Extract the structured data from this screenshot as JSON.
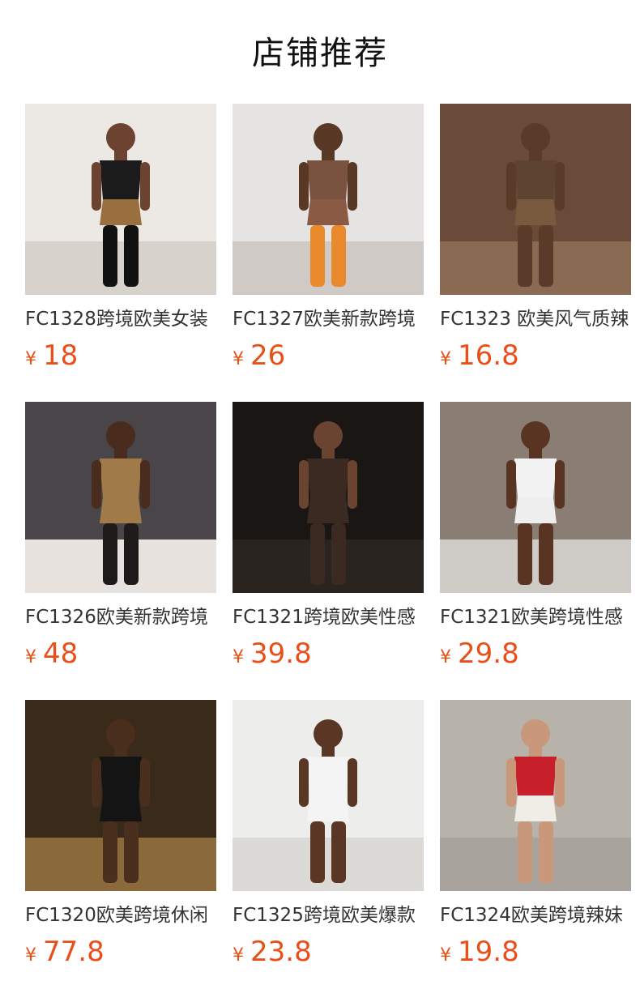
{
  "section": {
    "title": "店铺推荐"
  },
  "currency_symbol": "¥",
  "colors": {
    "price": "#e8501a",
    "title": "#111111",
    "name": "#333333"
  },
  "products": [
    {
      "name": "FC1328跨境欧美女装",
      "price": "18",
      "bg": "#ece8e4",
      "floor": "#d8d2cc",
      "skin": "#6b4330",
      "top": "#1b1b1b",
      "bottom": "#9a7040",
      "legs": "#111111"
    },
    {
      "name": "FC1327欧美新款跨境",
      "price": "26",
      "bg": "#e6e4e2",
      "floor": "#cfcac6",
      "skin": "#5a3826",
      "top": "#7a5240",
      "bottom": "#8a5a44",
      "legs": "#e88a2c"
    },
    {
      "name": "FC1323 欧美风气质辣",
      "price": "16.8",
      "bg": "#6a4a38",
      "floor": "#8a6a52",
      "skin": "#5a3a28",
      "top": "#5e4330",
      "bottom": "#7a5a3e",
      "legs": "#5a3a28"
    },
    {
      "name": "FC1326欧美新款跨境",
      "price": "48",
      "bg": "#4a4548",
      "floor": "#e8e2de",
      "skin": "#4a2c1e",
      "top": "#a07a48",
      "bottom": "#a07a48",
      "legs": "#1e1a1a"
    },
    {
      "name": "FC1321跨境欧美性感",
      "price": "39.8",
      "bg": "#1a1614",
      "floor": "#2a2420",
      "skin": "#6a4430",
      "top": "#3a2a22",
      "bottom": "#3a2a22",
      "legs": "#3a2a22"
    },
    {
      "name": "FC1321欧美跨境性感",
      "price": "29.8",
      "bg": "#8a7e74",
      "floor": "#cfcbc6",
      "skin": "#5a3422",
      "top": "#f2f2f2",
      "bottom": "#eeeeee",
      "legs": "#5a3422"
    },
    {
      "name": "FC1320欧美跨境休闲",
      "price": "77.8",
      "bg": "#3a2a1a",
      "floor": "#8a6a3a",
      "skin": "#4a2e1e",
      "top": "#141414",
      "bottom": "#141414",
      "legs": "#4a2e1e"
    },
    {
      "name": "FC1325跨境欧美爆款",
      "price": "23.8",
      "bg": "#ededeb",
      "floor": "#dcdad6",
      "skin": "#5a3624",
      "top": "#f4f4f4",
      "bottom": "#f4f4f4",
      "legs": "#5a3624"
    },
    {
      "name": "FC1324欧美跨境辣妹",
      "price": "19.8",
      "bg": "#b7b2aa",
      "floor": "#a8a39c",
      "skin": "#c9987a",
      "top": "#c8202a",
      "bottom": "#f0ece6",
      "legs": "#c9987a"
    }
  ]
}
